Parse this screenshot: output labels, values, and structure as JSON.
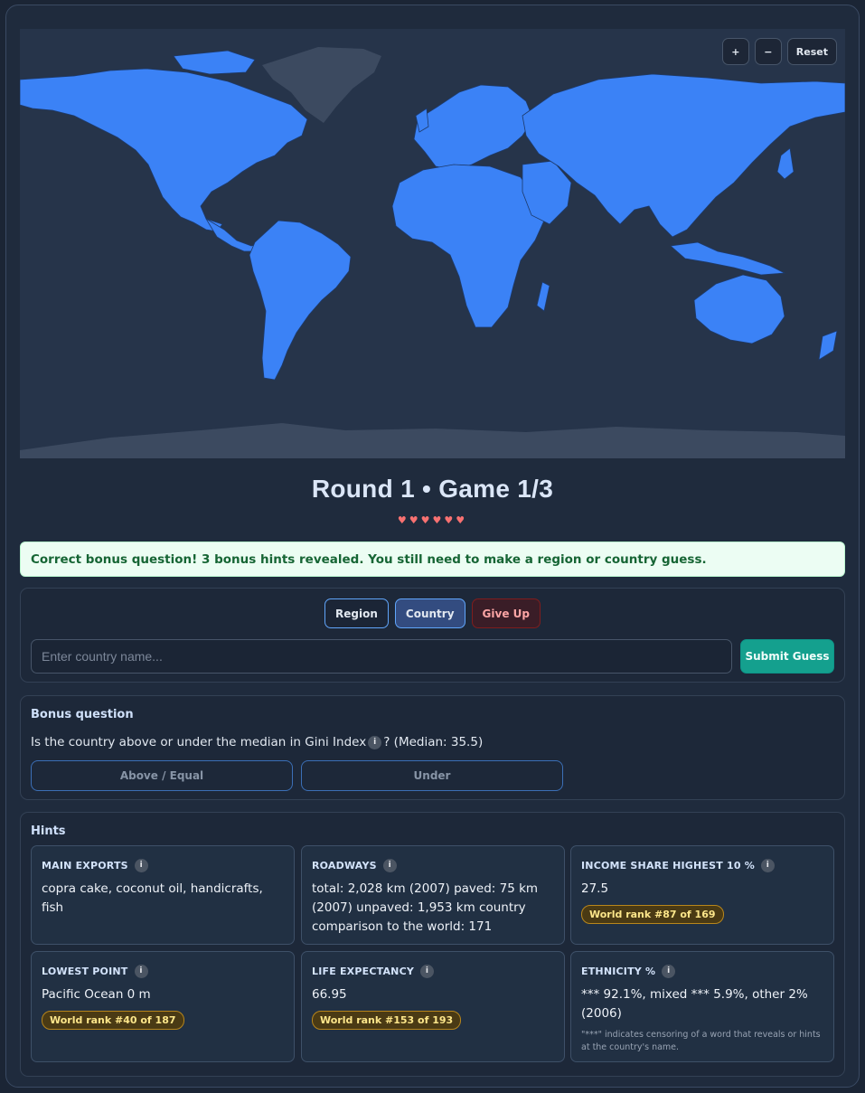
{
  "map": {
    "controls": {
      "zoom_in": "+",
      "zoom_out": "−",
      "reset": "Reset"
    }
  },
  "game": {
    "title": "Round 1 • Game 1/3",
    "hearts": "♥♥♥♥♥♥",
    "lives": 6
  },
  "notice": "Correct bonus question! 3 bonus hints revealed. You still need to make a region or country guess.",
  "guess": {
    "modes": {
      "region": "Region",
      "country": "Country",
      "give_up": "Give Up"
    },
    "selected_mode": "Country",
    "input_placeholder": "Enter country name...",
    "input_value": "",
    "submit_label": "Submit Guess"
  },
  "bonus": {
    "title": "Bonus question",
    "question_before": "Is the country above or under the median in Gini Index",
    "info_glyph": "i",
    "question_after": "? (Median: 35.5)",
    "above_label": "Above / Equal",
    "under_label": "Under"
  },
  "hints": {
    "title": "Hints",
    "info_glyph": "i",
    "items": [
      {
        "label": "MAIN EXPORTS",
        "value": "copra cake, coconut oil, handicrafts, fish"
      },
      {
        "label": "ROADWAYS",
        "value": "total: 2,028 km (2007) paved: 75 km (2007) unpaved: 1,953 km country comparison to the world: 171"
      },
      {
        "label": "INCOME SHARE HIGHEST 10 %",
        "value": "27.5",
        "rank": "World rank #87 of 169"
      },
      {
        "label": "LOWEST POINT",
        "value": "Pacific Ocean 0 m",
        "rank": "World rank #40 of 187"
      },
      {
        "label": "LIFE EXPECTANCY",
        "value": "66.95",
        "rank": "World rank #153 of 193"
      },
      {
        "label": "ETHNICITY %",
        "value": "*** 92.1%, mixed *** 5.9%, other 2% (2006)",
        "note": "\"***\" indicates censoring of a word that reveals or hints at the country's name."
      }
    ]
  },
  "colors": {
    "land": "#3b82f6",
    "ocean": "#26344a",
    "accent_teal": "#14a08e",
    "heart": "#f87171",
    "rank_gold": "#fde68a"
  }
}
